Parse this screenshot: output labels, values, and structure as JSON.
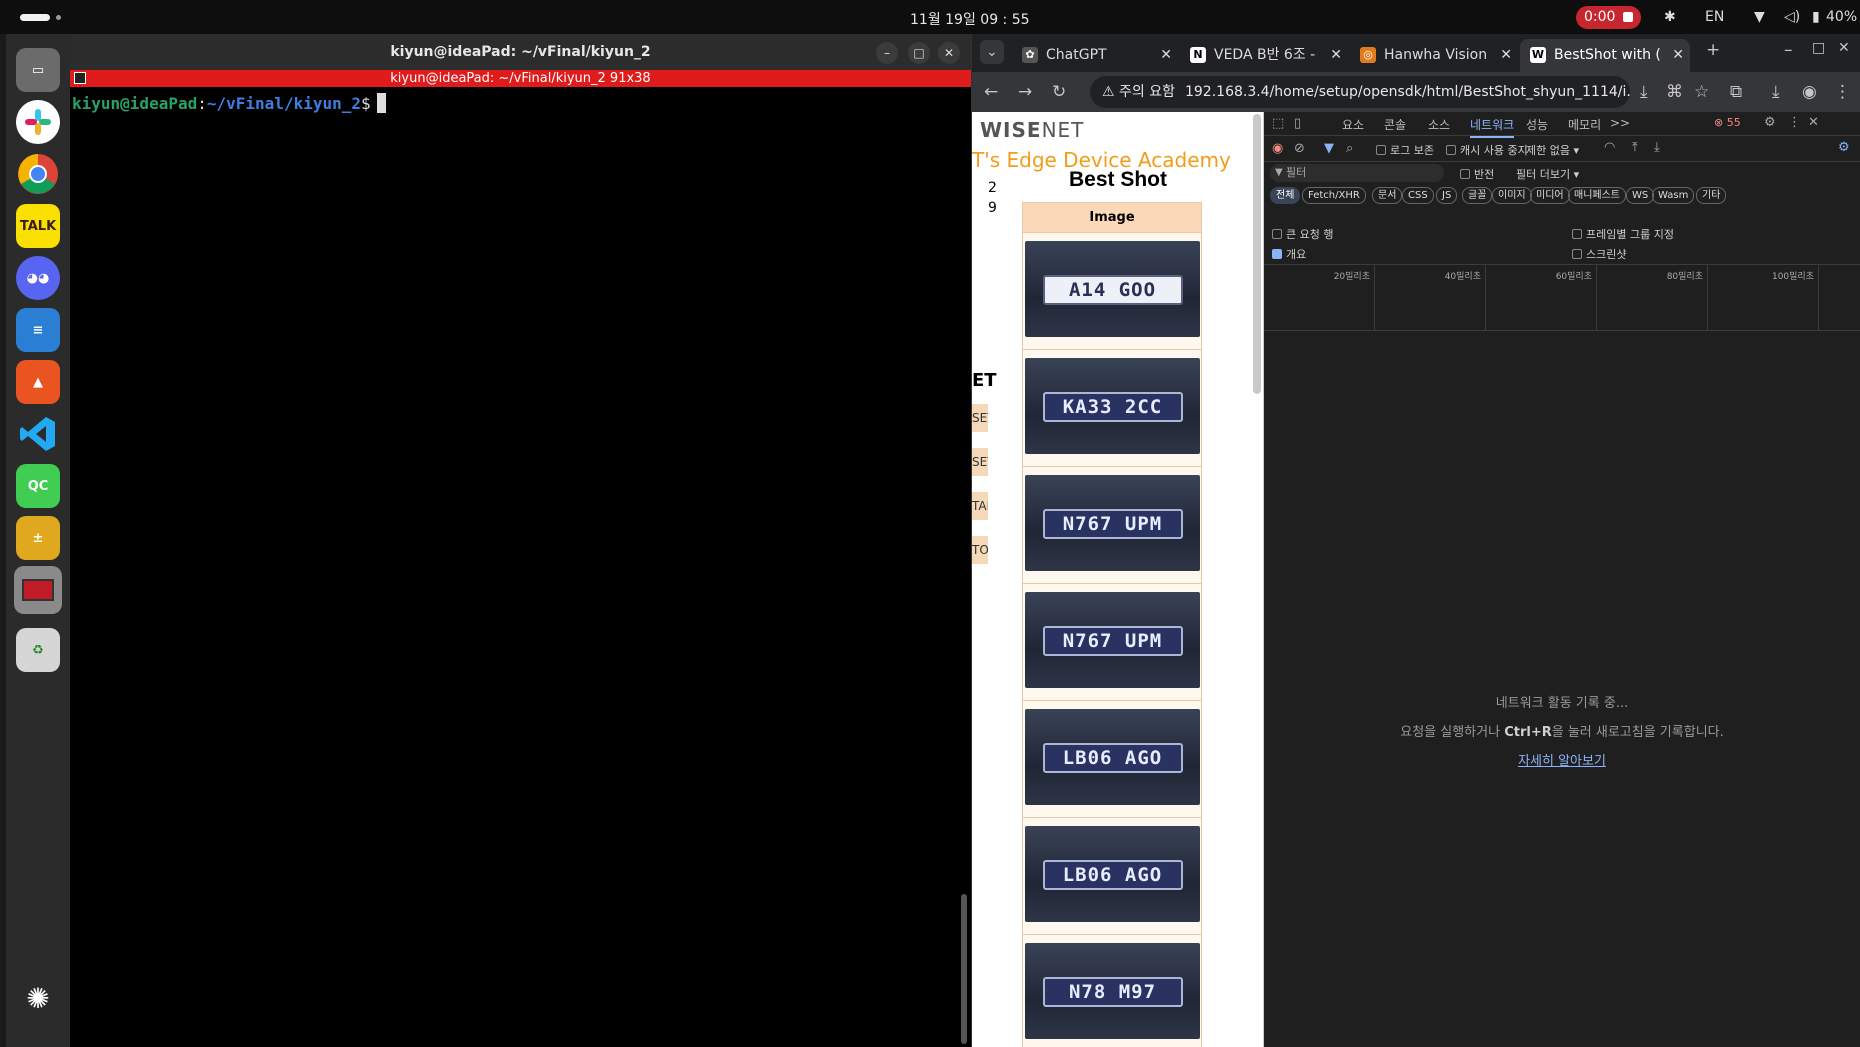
{
  "topbar": {
    "clock": "11월 19일  09 : 55",
    "recording_time": "0:00",
    "input_lang": "EN",
    "battery": "40%"
  },
  "dock": {
    "items": [
      "files-icon",
      "slack-icon",
      "chrome-icon",
      "kakaotalk-icon",
      "discord-icon",
      "writer-icon",
      "app-center-icon",
      "vscode-icon",
      "qt-creator-icon",
      "calculator-icon",
      "screen-recorder-icon",
      "trash-icon",
      "apps-grid-icon"
    ],
    "kakao_label": "TALK",
    "qt_label": "QC"
  },
  "terminal": {
    "title": "kiyun@ideaPad: ~/vFinal/kiyun_2",
    "tab_title": "kiyun@ideaPad: ~/vFinal/kiyun_2 91x38",
    "prompt_user": "kiyun@ideaPad",
    "prompt_sep": ":",
    "prompt_path": "~/vFinal/kiyun_2",
    "prompt_char": "$"
  },
  "browser": {
    "tabs": [
      {
        "label": "ChatGPT",
        "active": false
      },
      {
        "label": "VEDA B반 6조 -",
        "active": false
      },
      {
        "label": "Hanwha Vision",
        "active": false
      },
      {
        "label": "BestShot with (",
        "active": true
      }
    ],
    "new_tab": "+",
    "omnibox_warning": "⚠ 주의 요함",
    "url": "192.168.3.4/home/setup/opensdk/html/BestShot_shyun_1114/i..."
  },
  "page": {
    "logo_main": "WISE",
    "logo_suffix": "NET",
    "subtitle": "T's Edge Device Academy",
    "title": "Best Shot",
    "table_header": "Image",
    "side_buttons": [
      "SET",
      "SET",
      "TAR",
      "TO"
    ],
    "side_snippets": [
      "2",
      "9"
    ],
    "plates": [
      {
        "text": "A14 GOO",
        "style": "light"
      },
      {
        "text": "KA33 2CC",
        "style": "dark"
      },
      {
        "text": "N767 UPM",
        "style": "dark"
      },
      {
        "text": "N767 UPM",
        "style": "dark"
      },
      {
        "text": "LB06 AGO",
        "style": "dark"
      },
      {
        "text": "LB06 AGO",
        "style": "dark"
      },
      {
        "text": "N78 M97",
        "style": "dark"
      }
    ]
  },
  "devtools": {
    "panels": [
      "요소",
      "콘솔",
      "소스",
      "네트워크",
      "성능",
      "메모리"
    ],
    "more_panels": ">>",
    "error_count": "55",
    "preserve_log": "로그 보존",
    "disable_cache": "캐시 사용 중지",
    "throttling": "제한 없음",
    "filter_placeholder": "필터",
    "invert": "반전",
    "more_filters": "필터 더보기",
    "types": [
      "전체",
      "Fetch/XHR",
      "문서",
      "CSS",
      "JS",
      "글꼴",
      "이미지",
      "미디어",
      "매니페스트",
      "WS",
      "Wasm",
      "기타"
    ],
    "big_rows": "큰 요청 행",
    "group_by_frame": "프레임별 그룹 지정",
    "overview": "개요",
    "screenshots": "스크린샷",
    "ticks": [
      "20밀리초",
      "40밀리초",
      "60밀리초",
      "80밀리초",
      "100밀리초"
    ],
    "empty_line1": "네트워크 활동 기록 중...",
    "empty_line2_pre": "요청을 실행하거나 ",
    "empty_line2_key": "Ctrl+R",
    "empty_line2_post": "을 눌러 새로고침을 기록합니다.",
    "learn_more": "자세히 알아보기"
  }
}
